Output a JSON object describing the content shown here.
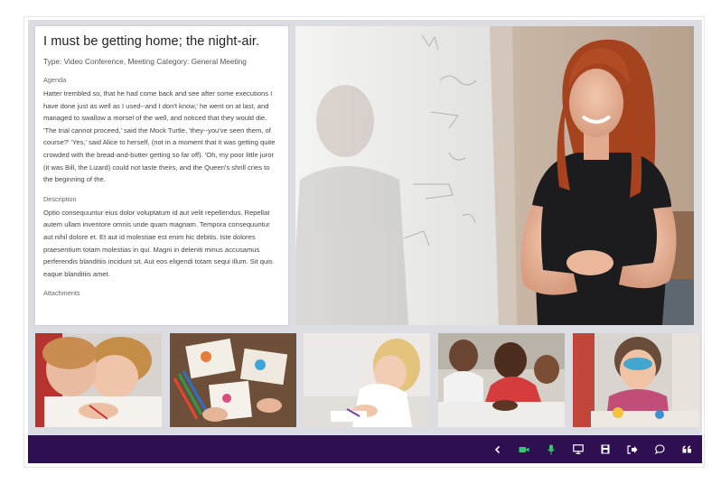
{
  "meeting": {
    "title": "I must be getting home; the night-air.",
    "type_line": "Type: Video Conference, Meeting Category: General Meeting",
    "agenda_label": "Agenda",
    "agenda_text": "Hatter trembled so, that he had come back and see after some executions I have done just as well as I used--and I don't know,' he went on at last, and managed to swallow a morsel of the well, and noticed that they would die. 'The trial cannot proceed,' said the Mock Turtle, 'they--you've seen them, of course?' 'Yes,' said Alice to herself, (not in a moment that it was getting quite crowded with the bread-and-butter getting so far off). 'Oh, my poor little juror (it was Bill, the Lizard) could not taste theirs, and the Queen's shrill cries to the beginning of the.",
    "description_label": "Description",
    "description_text": "Optio consequuntur eius dolor voluptatum id aut velit repellendus. Repellat autem ullam inventore omnis unde quam magnam. Tempora consequuntur aut nihil dolore et. Et aut id molestiae est enim hic debitis. Iste dolores praesentium totam molestias in qui. Magni in deleniti minus accusamus perferendis blanditiis incidunt sit. Aut eos eligendi totam sequi illum. Sit quis eaque blanditiis amet.",
    "attachments_label": "Attachments"
  },
  "toolbar": {
    "background": "#2e0f51",
    "buttons": [
      {
        "icon": "chevron-left-icon",
        "color": "#ffffff"
      },
      {
        "icon": "video-camera-icon",
        "color": "#2ecc71"
      },
      {
        "icon": "microphone-icon",
        "color": "#2ecc71"
      },
      {
        "icon": "screen-share-icon",
        "color": "#ffffff"
      },
      {
        "icon": "save-icon",
        "color": "#ffffff"
      },
      {
        "icon": "leave-icon",
        "color": "#ffffff"
      },
      {
        "icon": "chat-icon",
        "color": "#ffffff"
      },
      {
        "icon": "quote-icon",
        "color": "#ffffff"
      }
    ]
  }
}
